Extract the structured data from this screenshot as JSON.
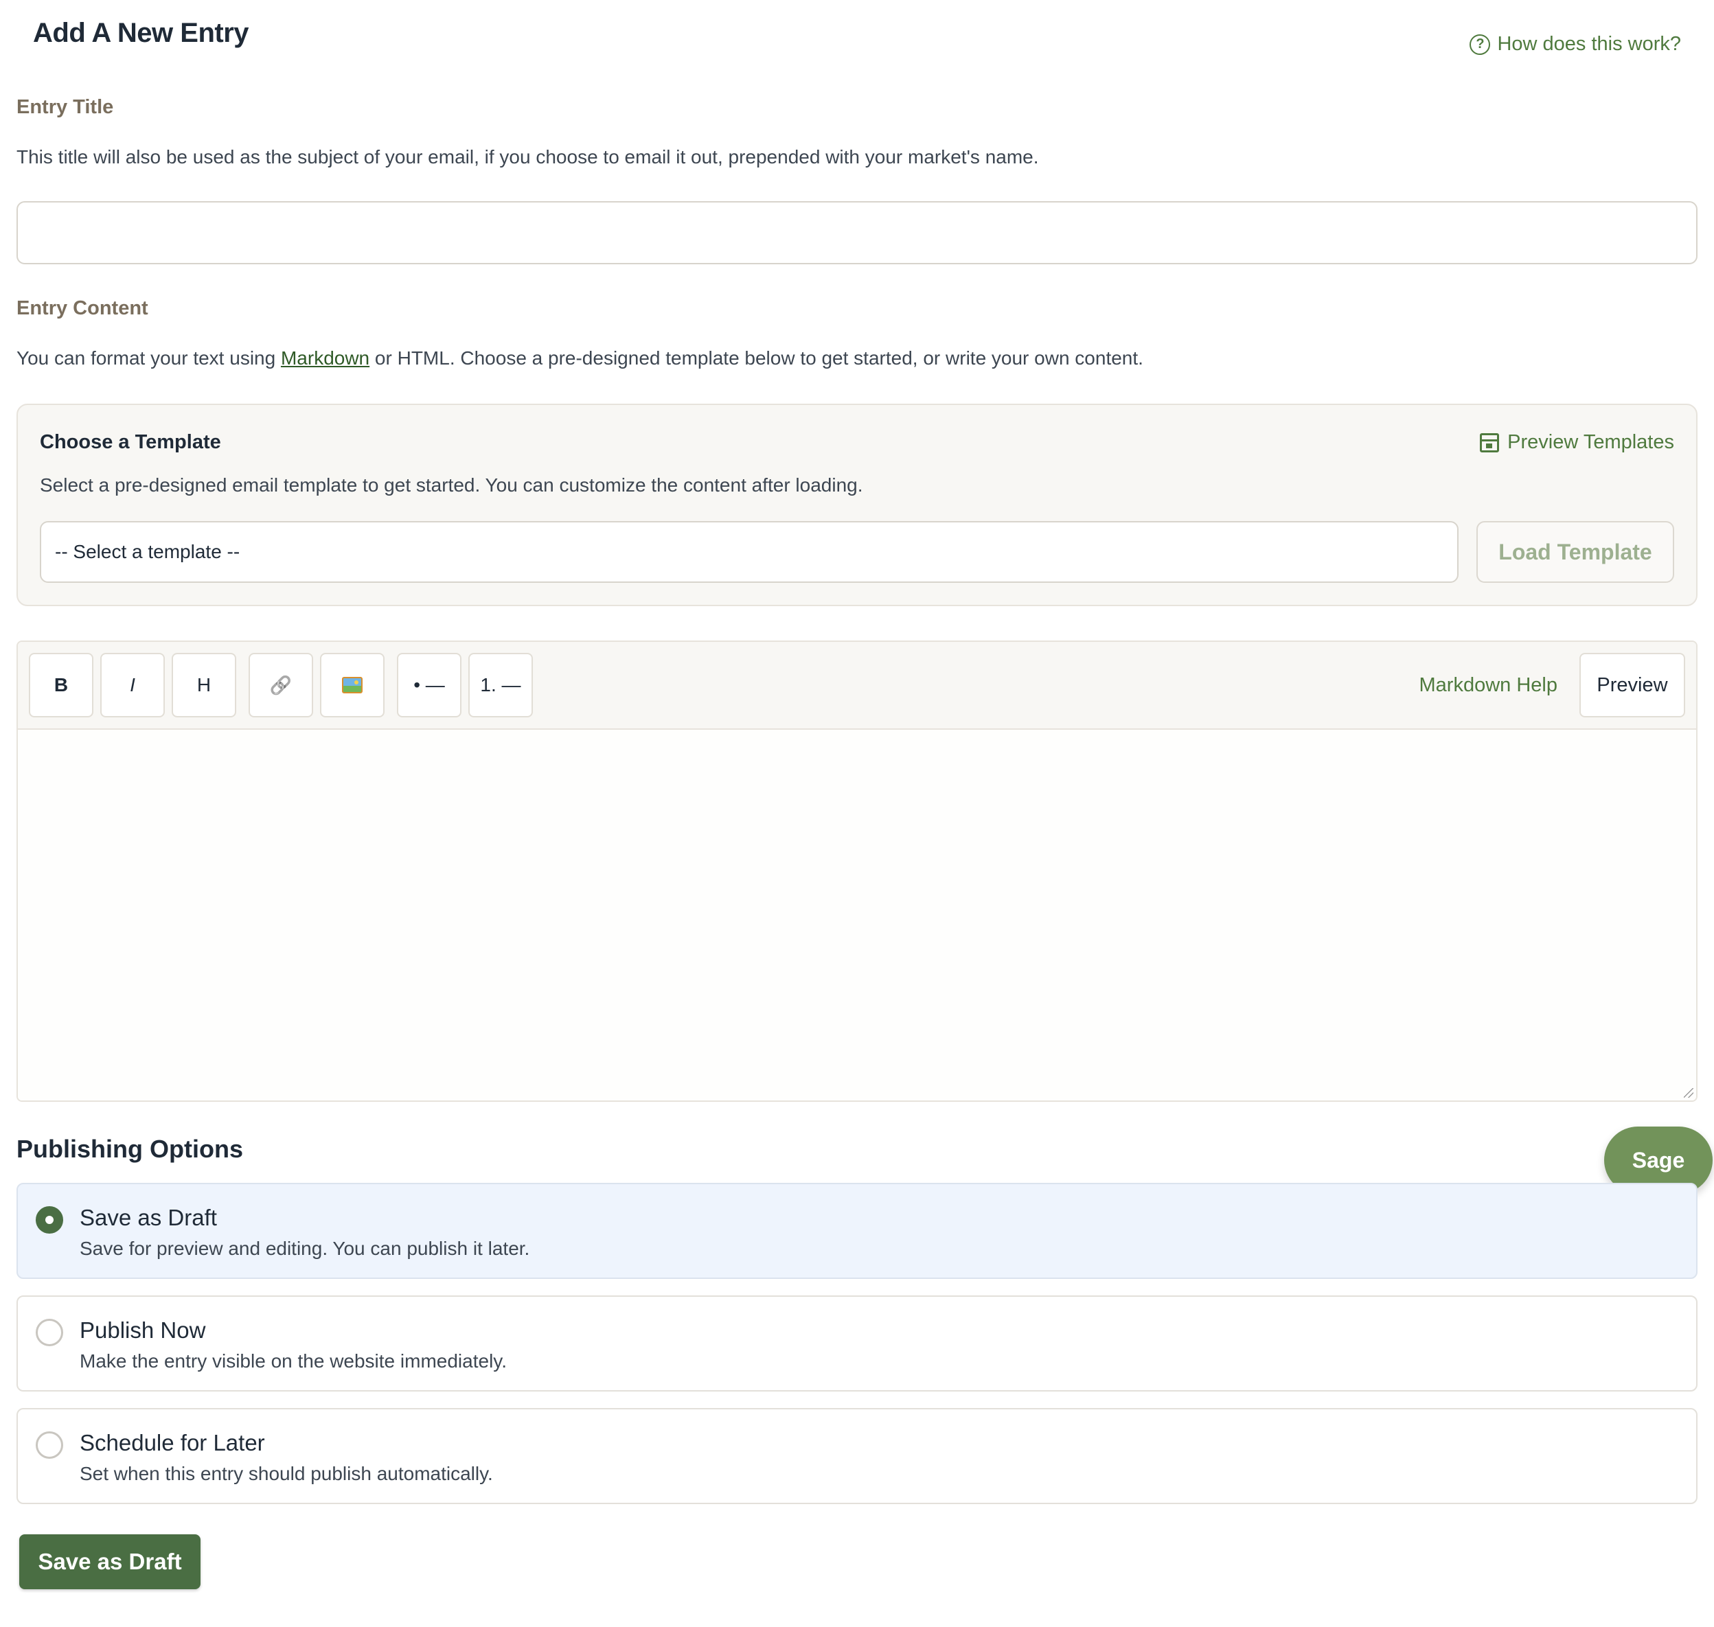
{
  "header": {
    "title": "Add A New Entry",
    "help_link": "How does this work?"
  },
  "entry_title": {
    "label": "Entry Title",
    "description": "This title will also be used as the subject of your email, if you choose to email it out, prepended with your market's name.",
    "value": "",
    "placeholder": ""
  },
  "entry_content": {
    "label": "Entry Content",
    "description_before": "You can format your text using ",
    "description_link": "Markdown",
    "description_after": " or HTML. Choose a pre-designed template below to get started, or write your own content."
  },
  "template": {
    "title": "Choose a Template",
    "preview_link": "Preview Templates",
    "description": "Select a pre-designed email template to get started. You can customize the content after loading.",
    "select_value": "-- Select a template --",
    "load_button": "Load Template"
  },
  "toolbar": {
    "bold": "B",
    "italic": "I",
    "heading": "H",
    "link_icon": "🔗",
    "bullet_list": "• —",
    "numbered_list": "1. —",
    "markdown_help": "Markdown Help",
    "preview": "Preview"
  },
  "editor": {
    "value": ""
  },
  "publishing": {
    "title": "Publishing Options",
    "assistant_button": "Sage",
    "options": [
      {
        "title": "Save as Draft",
        "description": "Save for preview and editing. You can publish it later.",
        "selected": true
      },
      {
        "title": "Publish Now",
        "description": "Make the entry visible on the website immediately.",
        "selected": false
      },
      {
        "title": "Schedule for Later",
        "description": "Set when this entry should publish automatically.",
        "selected": false
      }
    ],
    "submit_button": "Save as Draft"
  },
  "colors": {
    "accent_green": "#4f7a3e",
    "primary_button": "#4a6e43",
    "sage_button": "#72935a",
    "selected_option_bg": "#eef4fd"
  }
}
